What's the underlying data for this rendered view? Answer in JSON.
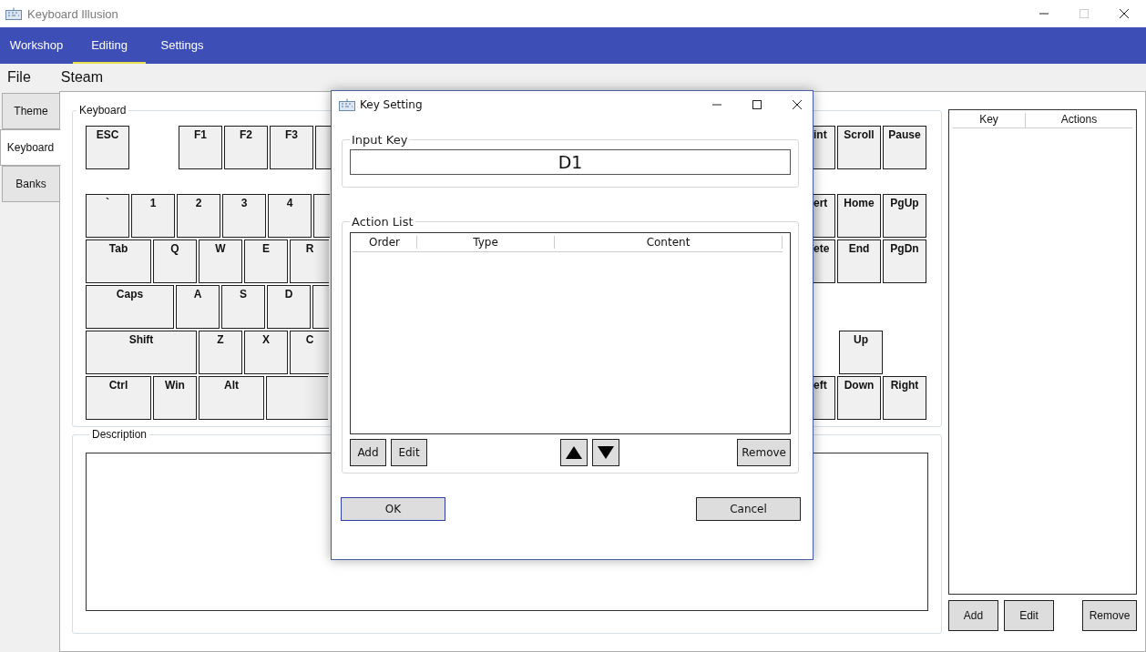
{
  "window": {
    "title": "Keyboard Illusion",
    "maximize_disabled": true
  },
  "nav_tabs": [
    {
      "label": "Workshop",
      "selected": false
    },
    {
      "label": "Editing",
      "selected": true
    },
    {
      "label": "Settings",
      "selected": false
    }
  ],
  "menu": [
    "File",
    "Steam"
  ],
  "side_tabs": [
    {
      "label": "Theme",
      "selected": false
    },
    {
      "label": "Keyboard",
      "selected": true
    },
    {
      "label": "Banks",
      "selected": false
    }
  ],
  "keyboard": {
    "title": "Keyboard",
    "left_rows": [
      [
        "ESC",
        "F1",
        "F2",
        "F3"
      ],
      [
        "`",
        "1",
        "2",
        "3",
        "4"
      ],
      [
        "Tab",
        "Q",
        "W",
        "E",
        "R"
      ],
      [
        "Caps",
        "A",
        "S",
        "D"
      ],
      [
        "Shift",
        "Z",
        "X",
        "C"
      ],
      [
        "Ctrl",
        "Win",
        "Alt"
      ]
    ],
    "right_rows": [
      [
        "int",
        "Scroll",
        "Pause"
      ],
      [
        "ert",
        "Home",
        "PgUp"
      ],
      [
        "ete",
        "End",
        "PgDn"
      ],
      [],
      [
        "Up"
      ],
      [
        "eft",
        "Down",
        "Right"
      ]
    ]
  },
  "description": {
    "title": "Description"
  },
  "key_list": {
    "columns": [
      "Key",
      "Actions"
    ],
    "buttons": [
      "Add",
      "Edit",
      "Remove"
    ]
  },
  "dialog": {
    "title": "Key Setting",
    "input_title": "Input Key",
    "input_value": "D1",
    "action_title": "Action List",
    "columns": [
      "Order",
      "Type",
      "Content"
    ],
    "list_buttons": [
      "Add",
      "Edit",
      "Remove"
    ],
    "buttons": [
      {
        "label": "OK",
        "default": true
      },
      {
        "label": "Cancel",
        "default": false
      }
    ]
  }
}
